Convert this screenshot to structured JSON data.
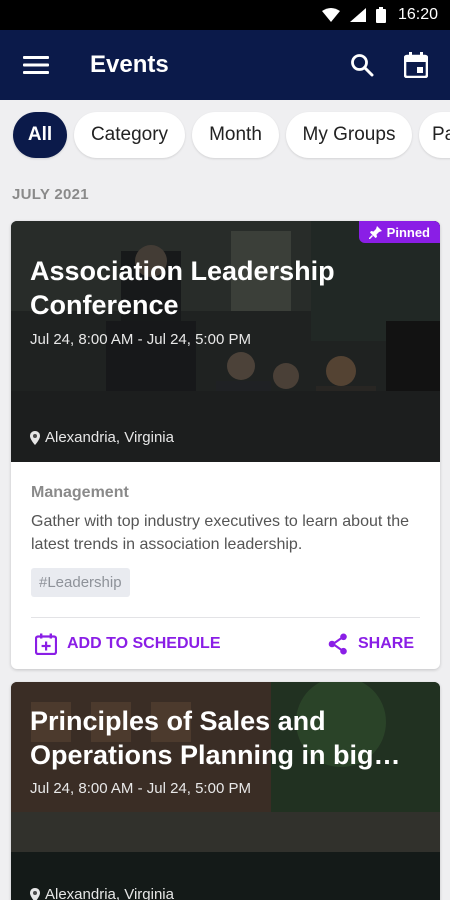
{
  "status_bar": {
    "time": "16:20"
  },
  "app_bar": {
    "title": "Events"
  },
  "filters": [
    {
      "label": "All",
      "active": true
    },
    {
      "label": "Category"
    },
    {
      "label": "Month"
    },
    {
      "label": "My Groups"
    },
    {
      "label": "Pa"
    }
  ],
  "section": {
    "label": "JULY 2021"
  },
  "events": [
    {
      "pinned_label": "Pinned",
      "title": "Association Leadership Conference",
      "dates": "Jul 24, 8:00 AM - Jul 24, 5:00 PM",
      "location": "Alexandria, Virginia",
      "category": "Management",
      "description": "Gather with top industry executives to learn about the latest trends in association leadership.",
      "tag": "#Leadership",
      "add_label": "ADD TO SCHEDULE",
      "share_label": "SHARE"
    },
    {
      "title": "Principles of Sales and Operations Planning in big…",
      "dates": "Jul 24, 8:00 AM - Jul 24, 5:00 PM",
      "location": "Alexandria, Virginia"
    }
  ],
  "colors": {
    "primary": "#0b1a4a",
    "accent": "#8a1ee6",
    "background": "#efeff1"
  }
}
